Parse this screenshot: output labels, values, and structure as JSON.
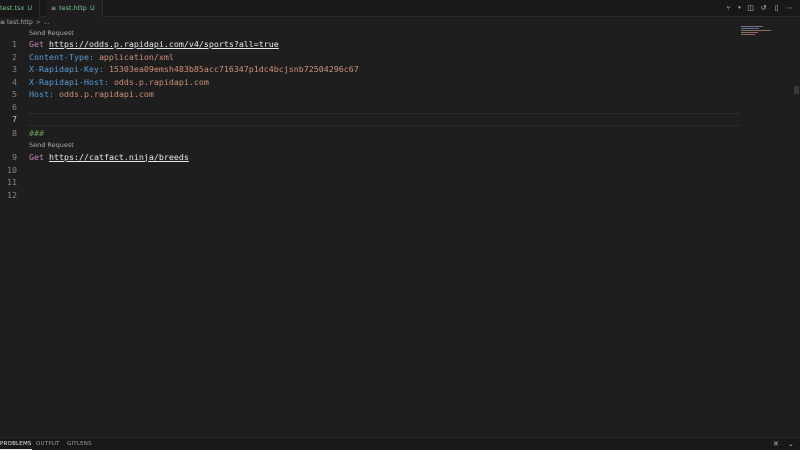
{
  "tabs": [
    {
      "icon": "ts-icon",
      "name": "test.tsx",
      "status": "U"
    },
    {
      "icon": "http-icon",
      "name": "test.http",
      "status": "U"
    }
  ],
  "breadcrumb": {
    "icon": "http-icon",
    "file": "test.http",
    "sep": ">",
    "more": "..."
  },
  "code_lens": {
    "send_request": "Send Request"
  },
  "lines": [
    {
      "n": "1",
      "method": "Get",
      "url": "https://odds.p.rapidapi.com/v4/sports?all=true"
    },
    {
      "n": "2",
      "key": "Content-Type:",
      "value": "application/xml"
    },
    {
      "n": "3",
      "key": "X-Rapidapi-Key:",
      "value": "15303ea09emsh483b85acc716347p1dc4bcjsnb72504296c67"
    },
    {
      "n": "4",
      "key": "X-Rapidapi-Host:",
      "value": "odds.p.rapidapi.com"
    },
    {
      "n": "5",
      "key": "Host:",
      "value": "odds.p.rapidapi.com"
    },
    {
      "n": "6"
    },
    {
      "n": "7"
    },
    {
      "n": "8",
      "comment": "###"
    },
    {
      "n": "9",
      "method": "Get",
      "url": "https://catfact.ninja/breeds"
    },
    {
      "n": "10"
    },
    {
      "n": "11"
    },
    {
      "n": "12"
    }
  ],
  "panel": {
    "tabs": [
      "PROBLEMS",
      "OUTPUT",
      "GITLENS"
    ]
  },
  "colors": {
    "keyword": "#c586c0",
    "header": "#569cd6",
    "value": "#ce9178",
    "comment": "#6a9955",
    "untracked": "#73c991"
  }
}
